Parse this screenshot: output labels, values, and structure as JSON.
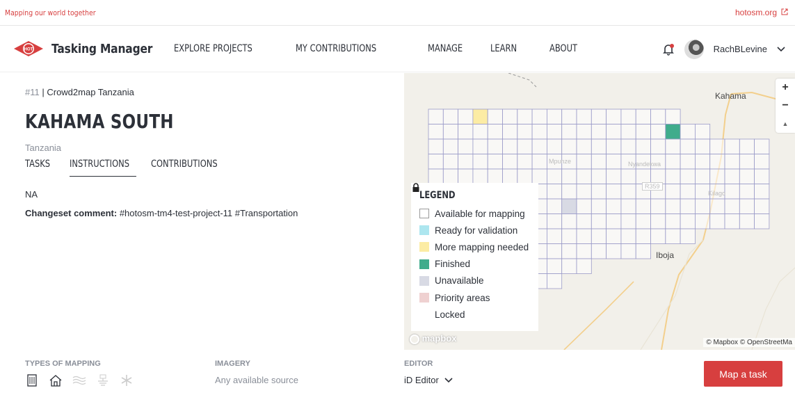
{
  "topbar": {
    "tagline": "Mapping our world together",
    "ext_link": "hotosm.org"
  },
  "nav": {
    "logo_badge": "HOT",
    "app_title": "Tasking Manager",
    "menu": [
      "EXPLORE PROJECTS",
      "MY CONTRIBUTIONS",
      "MANAGE",
      "LEARN",
      "ABOUT"
    ],
    "username": "RachBLevine"
  },
  "project": {
    "id": "#11",
    "org": "| Crowd2map Tanzania",
    "name": "KAHAMA SOUTH",
    "country": "Tanzania",
    "tabs": [
      "TASKS",
      "INSTRUCTIONS",
      "CONTRIBUTIONS"
    ],
    "active_tab": "INSTRUCTIONS",
    "instructions": "NA",
    "changeset_label": "Changeset comment:",
    "changeset_value": "#hotosm-tm4-test-project-11 #Transportation"
  },
  "map": {
    "labels": {
      "kahama": "Kahama",
      "iboja": "Iboja",
      "mpunze": "Mpunze",
      "nyandekwa": "Nyandekwa",
      "kilago": "Kilago",
      "road": "R359"
    },
    "zoom_in": "+",
    "zoom_out": "−",
    "compass": "▲",
    "mapbox_logo": "mapbox",
    "attribution": "© Mapbox © OpenStreetMa"
  },
  "legend": {
    "title": "LEGEND",
    "items": [
      {
        "label": "Available for mapping",
        "color": "#ffffff"
      },
      {
        "label": "Ready for validation",
        "color": "#ade6ef"
      },
      {
        "label": "More mapping needed",
        "color": "#fceca4"
      },
      {
        "label": "Finished",
        "color": "#40ac8c"
      },
      {
        "label": "Unavailable",
        "color": "#d8dae4"
      },
      {
        "label": "Priority areas",
        "color": "#efd1d1"
      },
      {
        "label": "Locked",
        "icon": "lock-icon"
      }
    ]
  },
  "footer": {
    "types_heading": "TYPES OF MAPPING",
    "imagery_heading": "IMAGERY",
    "imagery_value": "Any available source",
    "editor_heading": "EDITOR",
    "editor_value": "iD Editor",
    "map_task_button": "Map a task",
    "mapping_types": [
      "buildings-icon",
      "house-icon",
      "waterways-icon",
      "landuse-icon",
      "other-icon"
    ]
  },
  "colors": {
    "brand_red": "#d73f3f",
    "grid_line": "#9b9bc9"
  }
}
